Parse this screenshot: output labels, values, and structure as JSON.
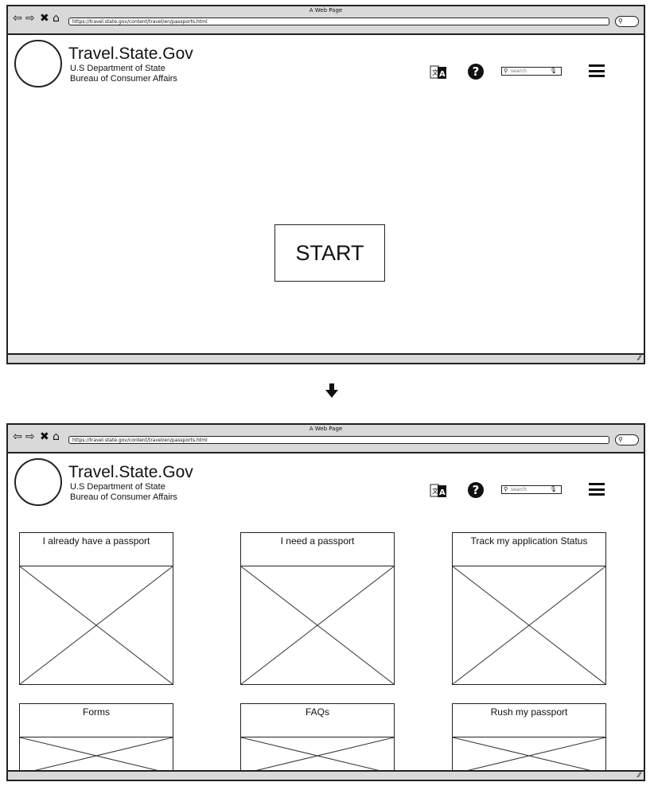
{
  "browser": {
    "page_title": "A Web Page",
    "url": "https://travel.state.gov/content/travel/en/passports.html"
  },
  "site": {
    "title": "Travel.State.Gov",
    "subtitle_line1": "U.S Department of State",
    "subtitle_line2": "Bureau of Consumer Affairs"
  },
  "header": {
    "icons": [
      "translate-icon",
      "help-icon",
      "search-icon",
      "microphone-icon",
      "menu-icon"
    ],
    "search_placeholder": "search"
  },
  "screen1": {
    "start_button_label": "START"
  },
  "flow": {
    "arrow_icon": "arrow-down-icon"
  },
  "screen2": {
    "cards": [
      {
        "label": "I already have a passport"
      },
      {
        "label": "I need a passport"
      },
      {
        "label": "Track my application Status"
      },
      {
        "label": "Forms"
      },
      {
        "label": "FAQs"
      },
      {
        "label": "Rush my passport"
      }
    ]
  }
}
